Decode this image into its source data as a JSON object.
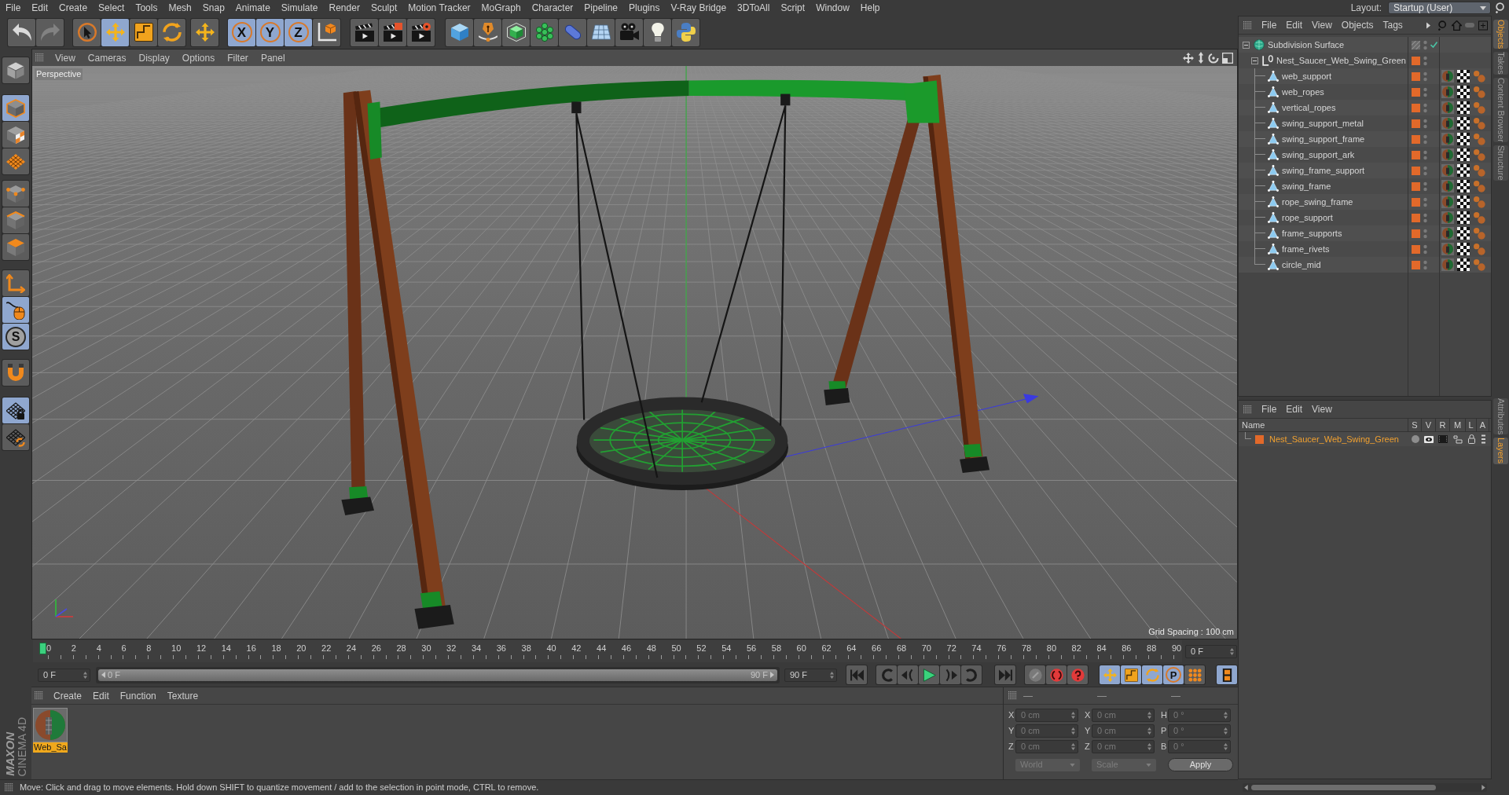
{
  "menu_bar": {
    "items": [
      "File",
      "Edit",
      "Create",
      "Select",
      "Tools",
      "Mesh",
      "Snap",
      "Animate",
      "Simulate",
      "Render",
      "Sculpt",
      "Motion Tracker",
      "MoGraph",
      "Character",
      "Pipeline",
      "Plugins",
      "V-Ray Bridge",
      "3DToAll",
      "Script",
      "Window",
      "Help"
    ],
    "layout_label": "Layout:",
    "layout_value": "Startup (User)"
  },
  "toolbar": {
    "groups": [
      [
        {
          "kind": "undo",
          "active": false,
          "disabled": false
        },
        {
          "kind": "redo",
          "active": false,
          "disabled": true
        }
      ],
      [
        {
          "kind": "live-select",
          "active": false
        },
        {
          "kind": "move",
          "active": true
        },
        {
          "kind": "scale",
          "active": false
        },
        {
          "kind": "rotate",
          "active": false
        }
      ],
      [
        {
          "kind": "recent-tool",
          "active": false
        }
      ],
      [
        {
          "kind": "axis",
          "label": "X",
          "active": true
        },
        {
          "kind": "axis",
          "label": "Y",
          "active": true
        },
        {
          "kind": "axis",
          "label": "Z",
          "active": true
        },
        {
          "kind": "coordinate-system",
          "active": false
        }
      ],
      [
        {
          "kind": "render-view",
          "active": false
        },
        {
          "kind": "render-to-viewer",
          "active": false
        },
        {
          "kind": "render-settings",
          "active": false
        }
      ],
      [
        {
          "kind": "cube",
          "active": false
        },
        {
          "kind": "pen",
          "active": false
        },
        {
          "kind": "subdivision",
          "active": false
        },
        {
          "kind": "cloner",
          "active": false
        },
        {
          "kind": "deformer",
          "active": false
        },
        {
          "kind": "floor",
          "active": false
        },
        {
          "kind": "camera",
          "active": false
        },
        {
          "kind": "light",
          "active": false
        },
        {
          "kind": "script",
          "active": false
        }
      ]
    ]
  },
  "tool_palette": {
    "groups": [
      [
        {
          "kind": "make-editable",
          "active": false
        }
      ],
      [
        {
          "kind": "model",
          "active": true
        },
        {
          "kind": "texture",
          "active": false
        },
        {
          "kind": "workplane",
          "active": false
        }
      ],
      [
        {
          "kind": "points",
          "active": false
        },
        {
          "kind": "edges",
          "active": false
        },
        {
          "kind": "polygons",
          "active": false
        }
      ],
      [
        {
          "kind": "axis-mode",
          "active": false
        },
        {
          "kind": "tweak",
          "active": true
        },
        {
          "kind": "solo",
          "label": "S",
          "active": true
        }
      ],
      [
        {
          "kind": "snap",
          "active": false
        }
      ],
      [
        {
          "kind": "lock-workplane",
          "active": true
        },
        {
          "kind": "planar-workplane",
          "active": false
        }
      ]
    ]
  },
  "viewport": {
    "menu": [
      "View",
      "Cameras",
      "Display",
      "Options",
      "Filter",
      "Panel"
    ],
    "camera": "Perspective",
    "grid_spacing": "Grid Spacing : 100 cm"
  },
  "objects_panel": {
    "menu": [
      "File",
      "Edit",
      "View",
      "Objects",
      "Tags"
    ],
    "tree": [
      {
        "name": "Subdivision Surface",
        "kind": "subdivision",
        "expanded": true,
        "enabled": true,
        "children": [
          {
            "name": "Nest_Saucer_Web_Swing_Green",
            "kind": "null",
            "expanded": true,
            "color": "#e2692a",
            "children": [
              {
                "name": "web_support",
                "kind": "polygon",
                "color": "#e2692a",
                "tags": [
                  {
                    "kind": "material"
                  },
                  {
                    "kind": "texture"
                  },
                  {
                    "kind": "selection"
                  }
                ]
              },
              {
                "name": "web_ropes",
                "kind": "polygon",
                "color": "#e2692a",
                "tags": [
                  {
                    "kind": "material"
                  },
                  {
                    "kind": "texture"
                  },
                  {
                    "kind": "selection"
                  }
                ]
              },
              {
                "name": "vertical_ropes",
                "kind": "polygon",
                "color": "#e2692a",
                "tags": [
                  {
                    "kind": "material"
                  },
                  {
                    "kind": "texture"
                  },
                  {
                    "kind": "selection"
                  }
                ]
              },
              {
                "name": "swing_support_metal",
                "kind": "polygon",
                "color": "#e2692a",
                "tags": [
                  {
                    "kind": "material"
                  },
                  {
                    "kind": "texture"
                  },
                  {
                    "kind": "selection"
                  }
                ]
              },
              {
                "name": "swing_support_frame",
                "kind": "polygon",
                "color": "#e2692a",
                "tags": [
                  {
                    "kind": "material"
                  },
                  {
                    "kind": "texture"
                  },
                  {
                    "kind": "selection"
                  }
                ]
              },
              {
                "name": "swing_support_ark",
                "kind": "polygon",
                "color": "#e2692a",
                "tags": [
                  {
                    "kind": "material"
                  },
                  {
                    "kind": "texture"
                  },
                  {
                    "kind": "selection"
                  }
                ]
              },
              {
                "name": "swing_frame_support",
                "kind": "polygon",
                "color": "#e2692a",
                "tags": [
                  {
                    "kind": "material"
                  },
                  {
                    "kind": "texture"
                  },
                  {
                    "kind": "selection"
                  }
                ]
              },
              {
                "name": "swing_frame",
                "kind": "polygon",
                "color": "#e2692a",
                "tags": [
                  {
                    "kind": "material"
                  },
                  {
                    "kind": "texture"
                  },
                  {
                    "kind": "selection"
                  }
                ]
              },
              {
                "name": "rope_swing_frame",
                "kind": "polygon",
                "color": "#e2692a",
                "tags": [
                  {
                    "kind": "material"
                  },
                  {
                    "kind": "texture"
                  },
                  {
                    "kind": "selection"
                  }
                ]
              },
              {
                "name": "rope_support",
                "kind": "polygon",
                "color": "#e2692a",
                "tags": [
                  {
                    "kind": "material"
                  },
                  {
                    "kind": "texture"
                  },
                  {
                    "kind": "selection"
                  }
                ]
              },
              {
                "name": "frame_supports",
                "kind": "polygon",
                "color": "#e2692a",
                "tags": [
                  {
                    "kind": "material"
                  },
                  {
                    "kind": "texture"
                  },
                  {
                    "kind": "selection"
                  }
                ]
              },
              {
                "name": "frame_rivets",
                "kind": "polygon",
                "color": "#e2692a",
                "tags": [
                  {
                    "kind": "material"
                  },
                  {
                    "kind": "texture"
                  },
                  {
                    "kind": "selection"
                  }
                ]
              },
              {
                "name": "circle_mid",
                "kind": "polygon",
                "color": "#e2692a",
                "tags": [
                  {
                    "kind": "material"
                  },
                  {
                    "kind": "texture"
                  },
                  {
                    "kind": "selection"
                  }
                ]
              }
            ]
          }
        ]
      }
    ]
  },
  "layers_panel": {
    "menu": [
      "File",
      "Edit",
      "View"
    ],
    "columns": [
      "Name",
      "S",
      "V",
      "R",
      "M",
      "L",
      "A"
    ],
    "rows": [
      {
        "name": "Nest_Saucer_Web_Swing_Green",
        "color": "#e2692a",
        "selected": true
      }
    ]
  },
  "side_tabs": {
    "upper": [
      {
        "label": "Objects",
        "selected": true
      },
      {
        "label": "Takes",
        "selected": false
      },
      {
        "label": "Content Browser",
        "selected": false
      },
      {
        "label": "Structure",
        "selected": false
      }
    ],
    "lower": [
      {
        "label": "Attributes",
        "selected": false
      },
      {
        "label": "Layers",
        "selected": true
      }
    ]
  },
  "timeline": {
    "ticks": [
      "0",
      "2",
      "4",
      "6",
      "8",
      "10",
      "12",
      "14",
      "16",
      "18",
      "20",
      "22",
      "24",
      "26",
      "28",
      "30",
      "32",
      "34",
      "36",
      "38",
      "40",
      "42",
      "44",
      "46",
      "48",
      "50",
      "52",
      "54",
      "56",
      "58",
      "60",
      "62",
      "64",
      "66",
      "68",
      "70",
      "72",
      "74",
      "76",
      "78",
      "80",
      "82",
      "84",
      "86",
      "88",
      "90"
    ],
    "level": 0,
    "current_frame": "0 F"
  },
  "playback": {
    "start_frame": "0 F",
    "range": {
      "start": "0 F",
      "end": "90 F",
      "level": 1
    },
    "end_frame": "90 F",
    "groups": [
      [
        {
          "kind": "go-to-start",
          "active": false
        }
      ],
      [
        {
          "kind": "previous-key",
          "active": false
        },
        {
          "kind": "previous-frame",
          "active": false
        },
        {
          "kind": "play",
          "active": false
        },
        {
          "kind": "next-frame",
          "active": false
        },
        {
          "kind": "next-key",
          "active": false
        }
      ],
      [
        {
          "kind": "go-to-end",
          "active": false
        }
      ],
      [
        {
          "kind": "record-off",
          "active": false
        },
        {
          "kind": "record",
          "active": false
        },
        {
          "kind": "autokey",
          "active": false
        }
      ],
      [
        {
          "kind": "key-position",
          "active": true
        },
        {
          "kind": "key-scale",
          "active": true
        },
        {
          "kind": "key-rotation",
          "active": true
        },
        {
          "kind": "key-parameter",
          "label": "P",
          "active": true
        },
        {
          "kind": "key-points",
          "active": false
        }
      ],
      [
        {
          "kind": "timeline",
          "active": true
        }
      ]
    ]
  },
  "material_manager": {
    "menu": [
      "Create",
      "Edit",
      "Function",
      "Texture"
    ],
    "materials": [
      {
        "name": "Web_Sa",
        "selected": true
      }
    ]
  },
  "coordinates": {
    "headers": [
      "—",
      "—",
      "—"
    ],
    "disabled": true,
    "rows": [
      [
        {
          "axis": "X",
          "value": "0 cm"
        },
        {
          "axis": "X",
          "value": "0 cm"
        },
        {
          "axis": "H",
          "value": "0 °"
        }
      ],
      [
        {
          "axis": "Y",
          "value": "0 cm"
        },
        {
          "axis": "Y",
          "value": "0 cm"
        },
        {
          "axis": "P",
          "value": "0 °"
        }
      ],
      [
        {
          "axis": "Z",
          "value": "0 cm"
        },
        {
          "axis": "Z",
          "value": "0 cm"
        },
        {
          "axis": "B",
          "value": "0 °"
        }
      ]
    ],
    "dropdowns": [
      "World",
      "Scale"
    ],
    "apply": "Apply"
  },
  "logo": {
    "brand": "MAXON",
    "product": "CINEMA 4D"
  },
  "status_bar": {
    "text": "Move: Click and drag to move elements. Hold down SHIFT to quantize movement / add to the selection in point mode, CTRL to remove."
  }
}
